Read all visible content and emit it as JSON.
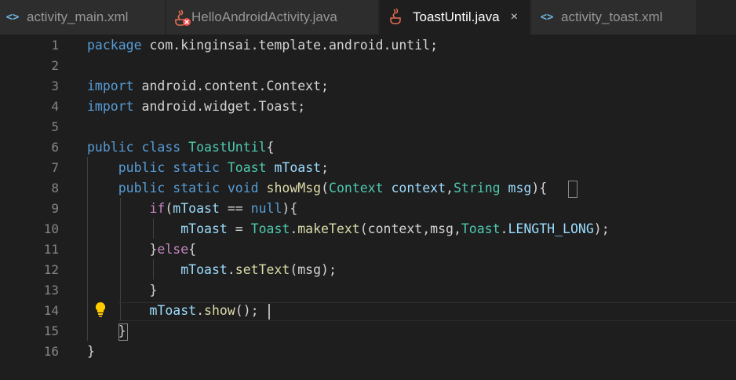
{
  "tabs": [
    {
      "label": "activity_main.xml",
      "icon": "xml-code-icon",
      "active": false
    },
    {
      "label": "HelloAndroidActivity.java",
      "icon": "java-error-icon",
      "active": false
    },
    {
      "label": "ToastUntil.java",
      "icon": "java-icon",
      "active": true,
      "close": "×"
    },
    {
      "label": "activity_toast.xml",
      "icon": "xml-code-icon",
      "active": false
    }
  ],
  "xml_icon_glyph": "<>",
  "colors": {
    "keyword": "#569cd6",
    "control": "#c586c0",
    "type": "#4ec9b0",
    "function": "#dcdcaa",
    "variable": "#9cdcfe",
    "plain": "#d4d4d4",
    "line_number": "#858585",
    "background": "#1e1e1e",
    "tabbar": "#252526",
    "java_icon": "#e76f51",
    "error_badge": "#f14c4c",
    "bulb": "#ffcc00"
  },
  "editor": {
    "lines": [
      {
        "n": "1",
        "tokens": [
          {
            "t": "package",
            "c": "kw"
          },
          {
            "t": " com.kinginsai.template.android.until;",
            "c": ""
          }
        ]
      },
      {
        "n": "2",
        "tokens": []
      },
      {
        "n": "3",
        "tokens": [
          {
            "t": "import",
            "c": "kw"
          },
          {
            "t": " android.content.Context;",
            "c": ""
          }
        ]
      },
      {
        "n": "4",
        "tokens": [
          {
            "t": "import",
            "c": "kw"
          },
          {
            "t": " android.widget.Toast;",
            "c": ""
          }
        ]
      },
      {
        "n": "5",
        "tokens": []
      },
      {
        "n": "6",
        "tokens": [
          {
            "t": "public",
            "c": "kw"
          },
          {
            "t": " ",
            "c": ""
          },
          {
            "t": "class",
            "c": "kw"
          },
          {
            "t": " ",
            "c": ""
          },
          {
            "t": "ToastUntil",
            "c": "ty"
          },
          {
            "t": "{",
            "c": ""
          }
        ]
      },
      {
        "n": "7",
        "tokens": [
          {
            "t": "    ",
            "c": ""
          },
          {
            "t": "public",
            "c": "kw"
          },
          {
            "t": " ",
            "c": ""
          },
          {
            "t": "static",
            "c": "kw"
          },
          {
            "t": " ",
            "c": ""
          },
          {
            "t": "Toast",
            "c": "ty"
          },
          {
            "t": " ",
            "c": ""
          },
          {
            "t": "mToast",
            "c": "var"
          },
          {
            "t": ";",
            "c": ""
          }
        ]
      },
      {
        "n": "8",
        "tokens": [
          {
            "t": "    ",
            "c": ""
          },
          {
            "t": "public",
            "c": "kw"
          },
          {
            "t": " ",
            "c": ""
          },
          {
            "t": "static",
            "c": "kw"
          },
          {
            "t": " ",
            "c": ""
          },
          {
            "t": "void",
            "c": "kw"
          },
          {
            "t": " ",
            "c": ""
          },
          {
            "t": "showMsg",
            "c": "fn"
          },
          {
            "t": "(",
            "c": ""
          },
          {
            "t": "Context",
            "c": "ty"
          },
          {
            "t": " ",
            "c": ""
          },
          {
            "t": "context",
            "c": "var"
          },
          {
            "t": ",",
            "c": ""
          },
          {
            "t": "String",
            "c": "ty"
          },
          {
            "t": " ",
            "c": ""
          },
          {
            "t": "msg",
            "c": "var"
          },
          {
            "t": "){",
            "c": ""
          }
        ]
      },
      {
        "n": "9",
        "tokens": [
          {
            "t": "        ",
            "c": ""
          },
          {
            "t": "if",
            "c": "ctl"
          },
          {
            "t": "(",
            "c": ""
          },
          {
            "t": "mToast",
            "c": "var"
          },
          {
            "t": " == ",
            "c": ""
          },
          {
            "t": "null",
            "c": "kw"
          },
          {
            "t": "){",
            "c": ""
          }
        ]
      },
      {
        "n": "10",
        "tokens": [
          {
            "t": "            ",
            "c": ""
          },
          {
            "t": "mToast",
            "c": "var"
          },
          {
            "t": " = ",
            "c": ""
          },
          {
            "t": "Toast",
            "c": "ty"
          },
          {
            "t": ".",
            "c": ""
          },
          {
            "t": "makeText",
            "c": "fn"
          },
          {
            "t": "(context,msg,",
            "c": ""
          },
          {
            "t": "Toast",
            "c": "ty"
          },
          {
            "t": ".",
            "c": ""
          },
          {
            "t": "LENGTH_LONG",
            "c": "var"
          },
          {
            "t": ");",
            "c": ""
          }
        ]
      },
      {
        "n": "11",
        "tokens": [
          {
            "t": "        }",
            "c": ""
          },
          {
            "t": "else",
            "c": "ctl"
          },
          {
            "t": "{",
            "c": ""
          }
        ]
      },
      {
        "n": "12",
        "tokens": [
          {
            "t": "            ",
            "c": ""
          },
          {
            "t": "mToast",
            "c": "var"
          },
          {
            "t": ".",
            "c": ""
          },
          {
            "t": "setText",
            "c": "fn"
          },
          {
            "t": "(msg);",
            "c": ""
          }
        ]
      },
      {
        "n": "13",
        "tokens": [
          {
            "t": "        }",
            "c": ""
          }
        ]
      },
      {
        "n": "14",
        "tokens": [
          {
            "t": "        ",
            "c": ""
          },
          {
            "t": "mToast",
            "c": "var"
          },
          {
            "t": ".",
            "c": ""
          },
          {
            "t": "show",
            "c": "fn"
          },
          {
            "t": "();",
            "c": ""
          }
        ]
      },
      {
        "n": "15",
        "tokens": [
          {
            "t": "    }",
            "c": ""
          }
        ]
      },
      {
        "n": "16",
        "tokens": [
          {
            "t": "}",
            "c": ""
          }
        ]
      }
    ]
  }
}
